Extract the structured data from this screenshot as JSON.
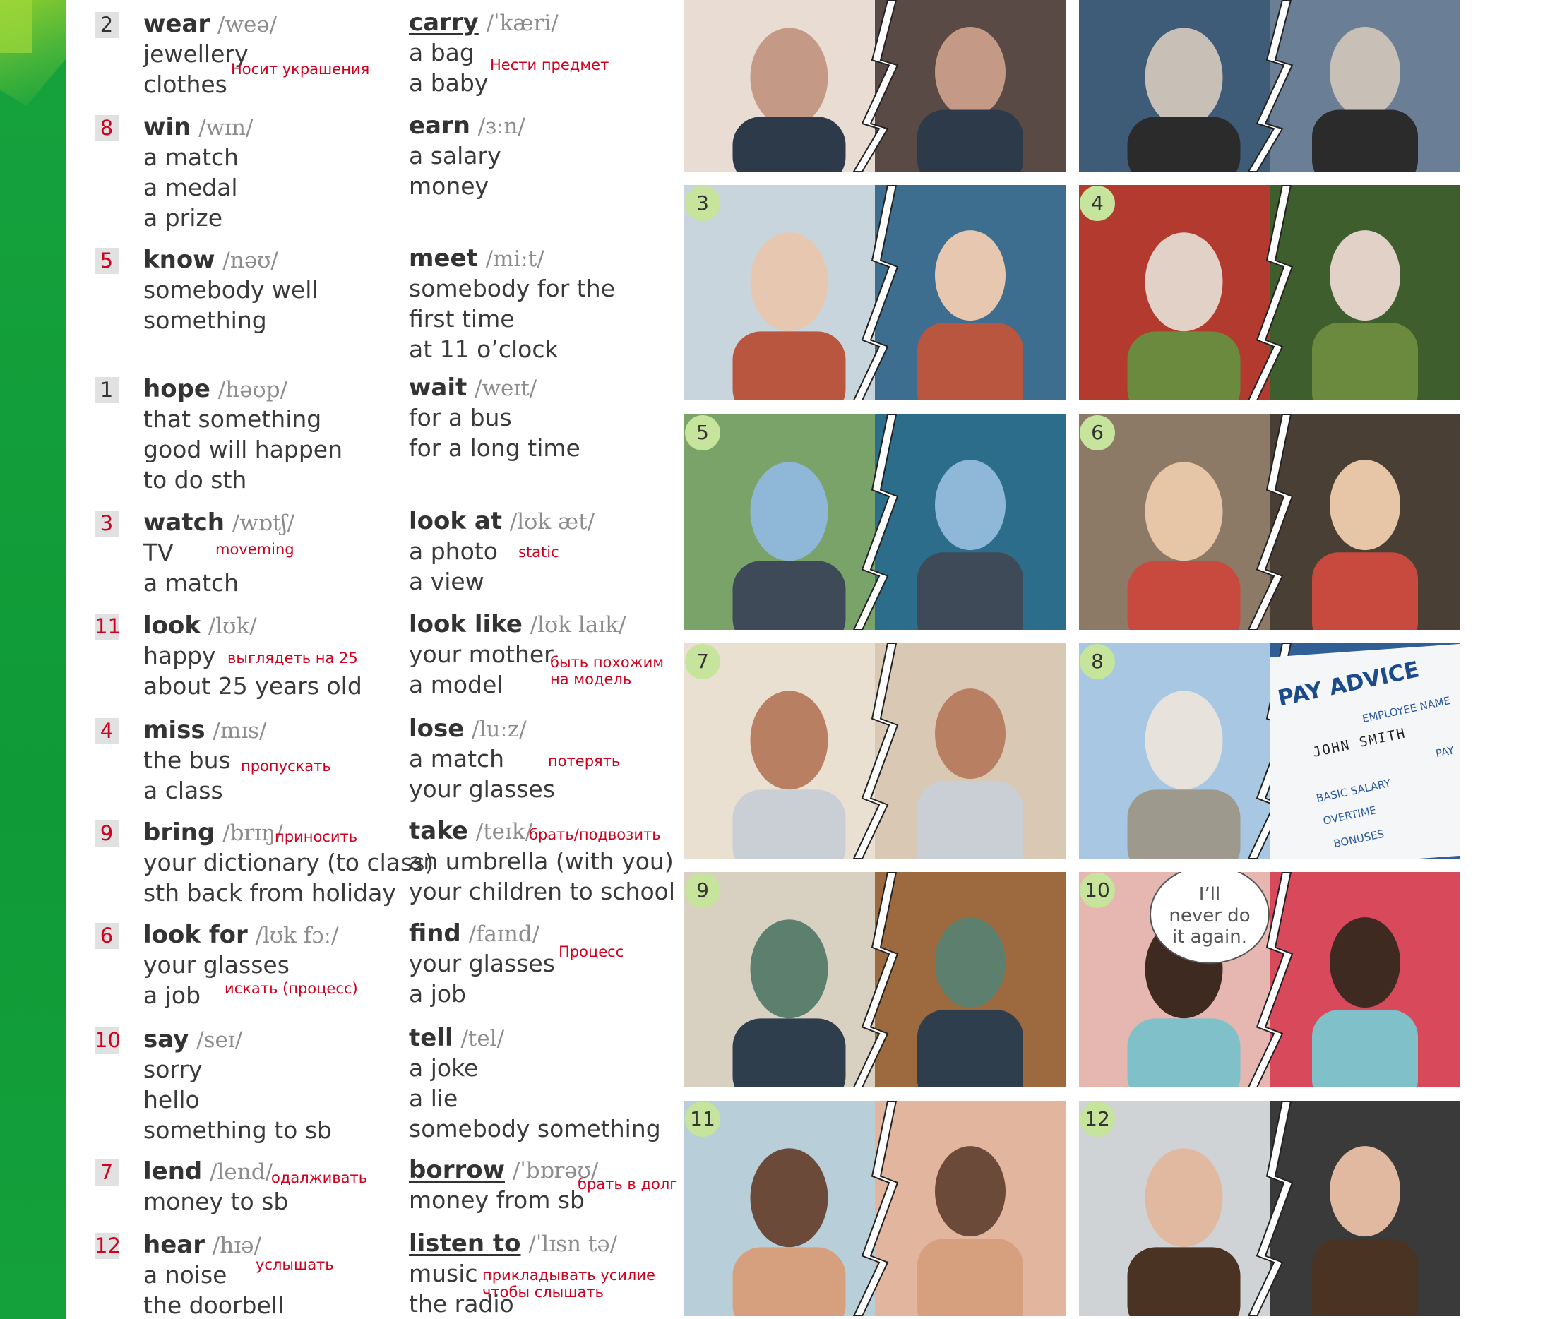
{
  "entries": [
    {
      "num": "2",
      "numRed": false,
      "word": "wear",
      "ipa": "/weə/",
      "lines": [
        "jewellery",
        "clothes"
      ],
      "note": "Носит украшения",
      "word2": "carry",
      "ipa2": "/ˈkæri/",
      "ul2": true,
      "lines2": [
        "a bag",
        "a baby"
      ],
      "note2": "Нести предмет"
    },
    {
      "num": "8",
      "numRed": true,
      "word": "win",
      "ipa": "/wɪn/",
      "lines": [
        "a match",
        "a medal",
        "a prize"
      ],
      "word2": "earn",
      "ipa2": "/ɜːn/",
      "lines2": [
        "a salary",
        "money"
      ]
    },
    {
      "num": "5",
      "numRed": true,
      "word": "know",
      "ipa": "/nəʊ/",
      "lines": [
        "somebody well",
        "something"
      ],
      "word2": "meet",
      "ipa2": "/miːt/",
      "lines2": [
        "somebody for the",
        "  first time",
        "at 11 o’clock"
      ]
    },
    {
      "num": "1",
      "numRed": false,
      "word": "hope",
      "ipa": "/həʊp/",
      "lines": [
        "that something",
        "  good will happen",
        "to do sth"
      ],
      "word2": "wait",
      "ipa2": "/weɪt/",
      "lines2": [
        "for a bus",
        "for a long time"
      ]
    },
    {
      "num": "3",
      "numRed": true,
      "word": "watch",
      "ipa": "/wɒtʃ/",
      "lines": [
        "TV",
        "a match"
      ],
      "note": "moveming",
      "word2": "look at",
      "ipa2": "/lʊk æt/",
      "lines2": [
        "a photo",
        "a view"
      ],
      "note2": "static"
    },
    {
      "num": "11",
      "numRed": true,
      "word": "look",
      "ipa": "/lʊk/",
      "lines": [
        "happy",
        "about 25 years old"
      ],
      "note": "выглядеть на 25",
      "word2": "look like",
      "ipa2": "/lʊk laɪk/",
      "lines2": [
        "your mother",
        "a model"
      ],
      "note2": "быть похожим",
      "note2b": "на модель"
    },
    {
      "num": "4",
      "numRed": true,
      "word": "miss",
      "ipa": "/mɪs/",
      "lines": [
        "the bus",
        "a class"
      ],
      "note": "пропускать",
      "word2": "lose",
      "ipa2": "/luːz/",
      "lines2": [
        "a match",
        "your glasses"
      ],
      "note2": "потерять"
    },
    {
      "num": "9",
      "numRed": true,
      "word": "bring",
      "ipa": "/brɪŋ/",
      "lines": [
        "your dictionary (to class)",
        "sth back from holiday"
      ],
      "note": "приносить",
      "word2": "take",
      "ipa2": "/teɪk/",
      "lines2": [
        "an umbrella (with you)",
        "your children to school"
      ],
      "note2": "брать/подвозить"
    },
    {
      "num": "6",
      "numRed": true,
      "word": "look for",
      "ipa": "/lʊk fɔː/",
      "lines": [
        "your glasses",
        "a job"
      ],
      "note": "искать (процесс)",
      "word2": "find",
      "ipa2": "/faɪnd/",
      "lines2": [
        "your glasses",
        "a job"
      ],
      "note2": "Процесс"
    },
    {
      "num": "10",
      "numRed": true,
      "word": "say",
      "ipa": "/seɪ/",
      "lines": [
        "sorry",
        "hello",
        "something to sb"
      ],
      "word2": "tell",
      "ipa2": "/tel/",
      "lines2": [
        "a joke",
        "a lie",
        "somebody something"
      ]
    },
    {
      "num": "7",
      "numRed": true,
      "word": "lend",
      "ipa": "/lend/",
      "lines": [
        "money to sb"
      ],
      "note": "одалживать",
      "word2": "borrow",
      "ipa2": "/ˈbɒrəʊ/",
      "ul2": true,
      "lines2": [
        "money from sb"
      ],
      "note2": "брать в долг"
    },
    {
      "num": "12",
      "numRed": true,
      "word": "hear",
      "ipa": "/hɪə/",
      "lines": [
        "a noise",
        "the doorbell"
      ],
      "note": "услышать",
      "word2": "listen to",
      "ipa2": "/ˈlɪsn tə/",
      "ul2": true,
      "lines2": [
        "music",
        "the radio"
      ],
      "note2": "прикладывать усилие",
      "note2b": "чтобы слышать"
    }
  ],
  "photos": [
    {
      "badge": ""
    },
    {
      "badge": ""
    },
    {
      "badge": "3"
    },
    {
      "badge": "4"
    },
    {
      "badge": "5"
    },
    {
      "badge": "6"
    },
    {
      "badge": "7"
    },
    {
      "badge": "8"
    },
    {
      "badge": "9"
    },
    {
      "badge": "10"
    },
    {
      "badge": "11"
    },
    {
      "badge": "12"
    }
  ],
  "pay_advice": {
    "title": "PAY ADVICE",
    "employee_name": "EMPLOYEE NAME",
    "name": "JOHN SMITH",
    "pay": "PAY",
    "rows": [
      "BASIC SALARY",
      "OVERTIME",
      "BONUSES"
    ]
  },
  "speech_bubble": {
    "l1": "I’ll",
    "l2": "never do",
    "l3": "it again."
  },
  "colors": {
    "green": "#16a23d",
    "red_note": "#d1001f",
    "badge": "#c6e49c",
    "num_box": "#e1e1e1"
  }
}
